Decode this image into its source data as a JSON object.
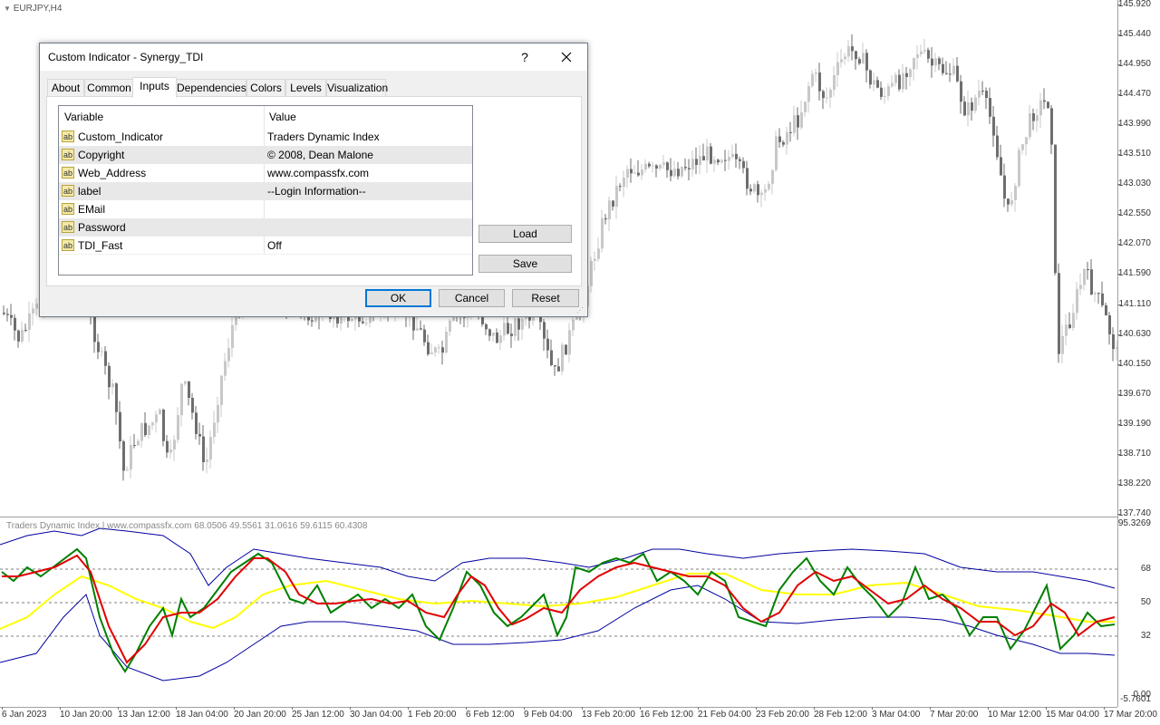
{
  "chart": {
    "symbol_label": "EURJPY,H4",
    "price_labels": [
      "145.920",
      "145.440",
      "144.950",
      "144.470",
      "143.990",
      "143.510",
      "143.030",
      "142.550",
      "142.070",
      "141.590",
      "141.110",
      "140.630",
      "140.150",
      "139.670",
      "139.190",
      "138.710",
      "138.220",
      "137.740"
    ],
    "time_labels": [
      "6 Jan 2023",
      "10 Jan 20:00",
      "13 Jan 12:00",
      "18 Jan 04:00",
      "20 Jan 20:00",
      "25 Jan 12:00",
      "30 Jan 04:00",
      "1 Feb 20:00",
      "6 Feb 12:00",
      "9 Feb 04:00",
      "13 Feb 20:00",
      "16 Feb 12:00",
      "21 Feb 04:00",
      "23 Feb 20:00",
      "28 Feb 12:00",
      "3 Mar 04:00",
      "7 Mar 20:00",
      "10 Mar 12:00",
      "15 Mar 04:00",
      "17 Mar 20:00"
    ],
    "colors": {
      "candle_bull": "#c8c8c8",
      "candle_bear": "#6e6e6e",
      "background": "#ffffff"
    }
  },
  "indicator": {
    "title": "Traders Dynamic Index | www.compassfx.com  68.0506 49.5561 31.0616 59.6115 60.4308",
    "level_labels": [
      "95.3269",
      "68",
      "50",
      "32",
      "0.00",
      "-5.7601"
    ],
    "colors": {
      "upper_band": "#0000a0",
      "lower_band": "#0000a0",
      "middle": "#ffff00",
      "rsi": "#008000",
      "signal": "#e00000",
      "levels": "#808080"
    }
  },
  "dialog": {
    "title": "Custom Indicator - Synergy_TDI",
    "help_label": "?",
    "close_label": "✕",
    "tabs": [
      {
        "label": "About"
      },
      {
        "label": "Common"
      },
      {
        "label": "Inputs"
      },
      {
        "label": "Dependencies"
      },
      {
        "label": "Colors"
      },
      {
        "label": "Levels"
      },
      {
        "label": "Visualization"
      }
    ],
    "active_tab": "Inputs",
    "grid": {
      "headers": [
        "Variable",
        "Value"
      ],
      "rows": [
        {
          "icon": "ab",
          "variable": "Custom_Indicator",
          "value": "Traders Dynamic Index"
        },
        {
          "icon": "ab",
          "variable": "Copyright",
          "value": "© 2008, Dean Malone"
        },
        {
          "icon": "ab",
          "variable": "Web_Address",
          "value": "www.compassfx.com"
        },
        {
          "icon": "ab",
          "variable": "label",
          "value": "--Login Information--"
        },
        {
          "icon": "ab",
          "variable": "EMail",
          "value": ""
        },
        {
          "icon": "ab",
          "variable": "Password",
          "value": ""
        },
        {
          "icon": "ab",
          "variable": "TDI_Fast",
          "value": "Off"
        }
      ]
    },
    "buttons": {
      "load": "Load",
      "save": "Save",
      "ok": "OK",
      "cancel": "Cancel",
      "reset": "Reset"
    }
  }
}
